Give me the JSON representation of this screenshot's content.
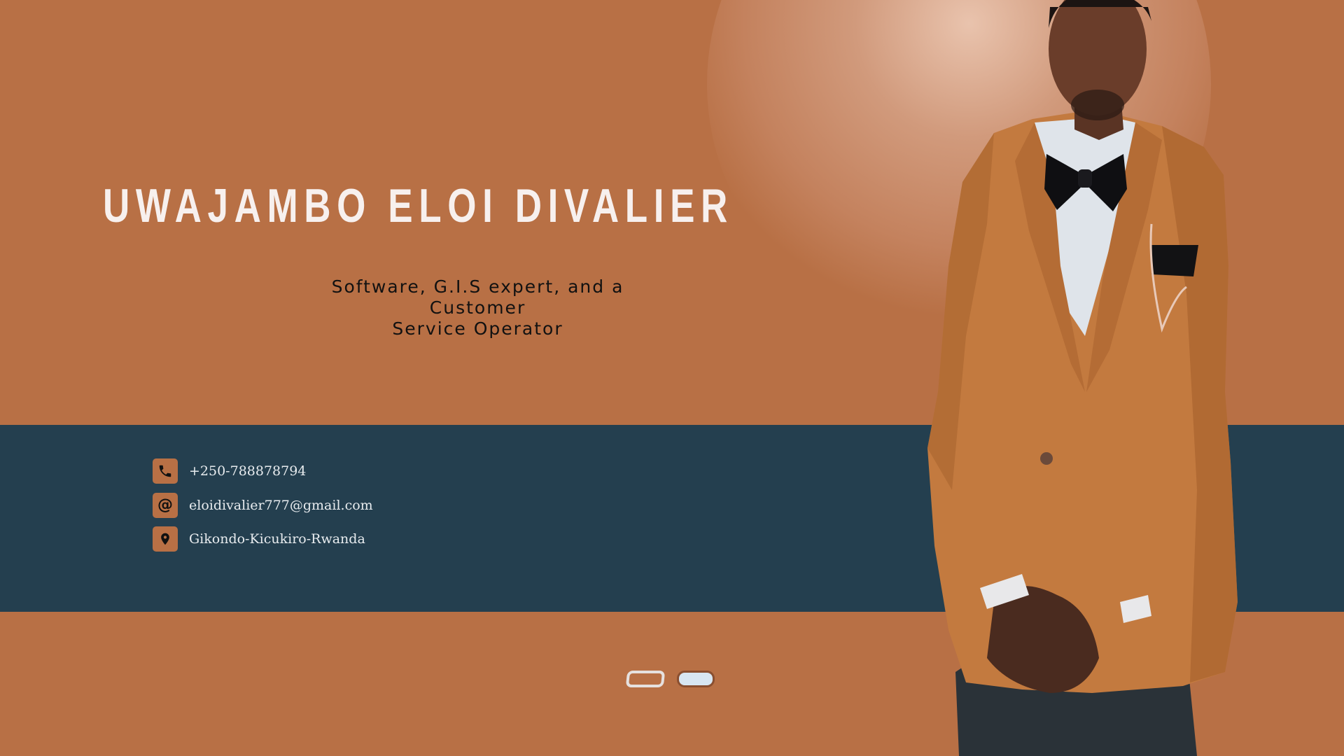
{
  "profile": {
    "name": "UWAJAMBO ELOI DIVALIER",
    "subtitle_line1": "Software, G.I.S expert, and a Customer",
    "subtitle_line2": "Service Operator"
  },
  "contacts": [
    {
      "icon": "phone-icon",
      "text": "+250-788878794"
    },
    {
      "icon": "at-icon",
      "text": "eloidivalier777@gmail.com",
      "symbol": "@"
    },
    {
      "icon": "map-pin-icon",
      "text": "Gikondo-Kicukiro-Rwanda"
    }
  ],
  "pager": {
    "count": 2,
    "active_index": 1
  },
  "colors": {
    "background": "#b87045",
    "band": "#243f4f",
    "title": "#f7f0ee",
    "icon_bg": "#b87045",
    "active_dot": "#d8e6f2"
  }
}
